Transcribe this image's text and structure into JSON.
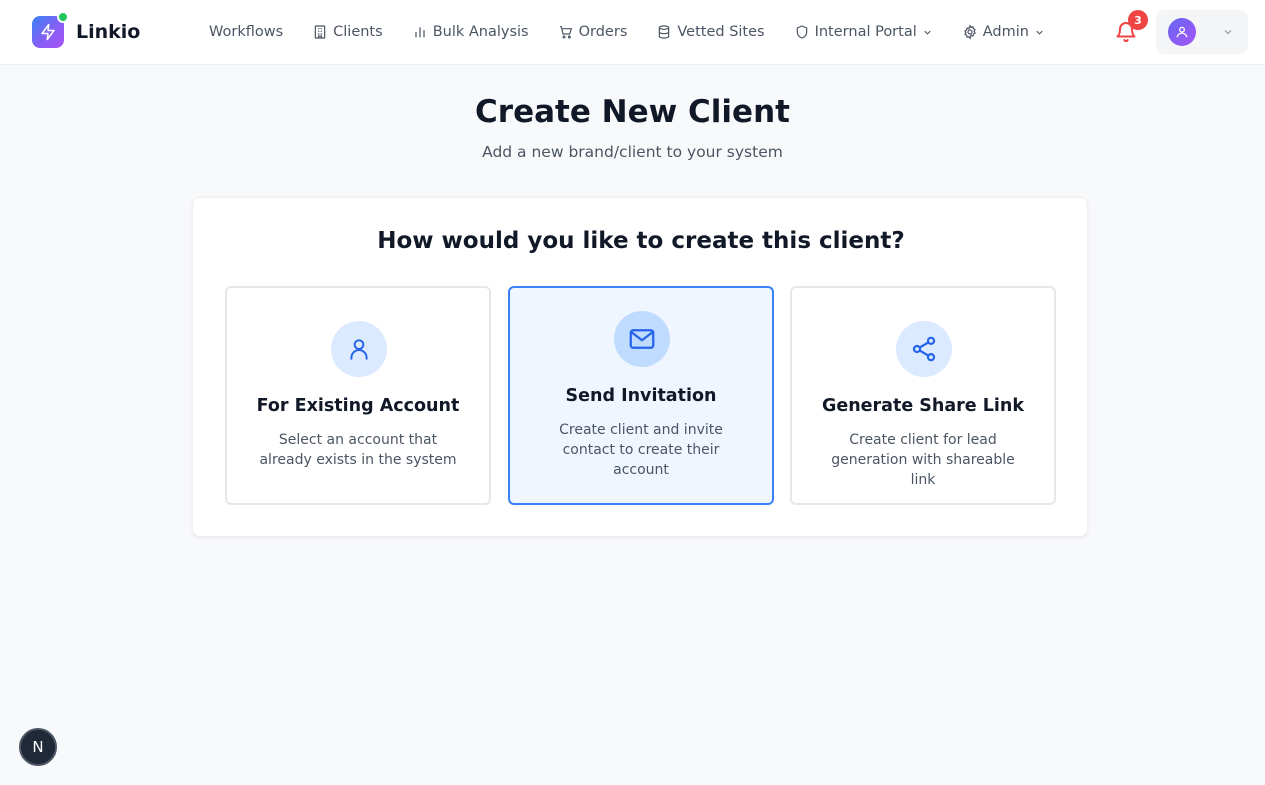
{
  "app": {
    "name": "Linkio"
  },
  "nav": {
    "items": [
      {
        "label": "Workflows",
        "icon": "none"
      },
      {
        "label": "Clients",
        "icon": "building-icon"
      },
      {
        "label": "Bulk Analysis",
        "icon": "bar-chart-icon"
      },
      {
        "label": "Orders",
        "icon": "cart-icon"
      },
      {
        "label": "Vetted Sites",
        "icon": "database-icon"
      },
      {
        "label": "Internal Portal",
        "icon": "shield-icon",
        "dropdown": true
      },
      {
        "label": "Admin",
        "icon": "gear-icon",
        "dropdown": true
      }
    ]
  },
  "notifications": {
    "count": "3"
  },
  "page": {
    "title": "Create New Client",
    "subtitle": "Add a new brand/client to your system"
  },
  "card": {
    "question": "How would you like to create this client?",
    "options": [
      {
        "title": "For Existing Account",
        "description": "Select an account that already exists in the system",
        "icon": "user-icon",
        "selected": false
      },
      {
        "title": "Send Invitation",
        "description": "Create client and invite contact to create their account",
        "icon": "mail-icon",
        "selected": true
      },
      {
        "title": "Generate Share Link",
        "description": "Create client for lead generation with shareable link",
        "icon": "share-icon",
        "selected": false
      }
    ]
  },
  "dev_badge": {
    "label": "N"
  },
  "colors": {
    "accent": "#3b82f6",
    "badge": "#ef4444",
    "online": "#22c55e"
  }
}
